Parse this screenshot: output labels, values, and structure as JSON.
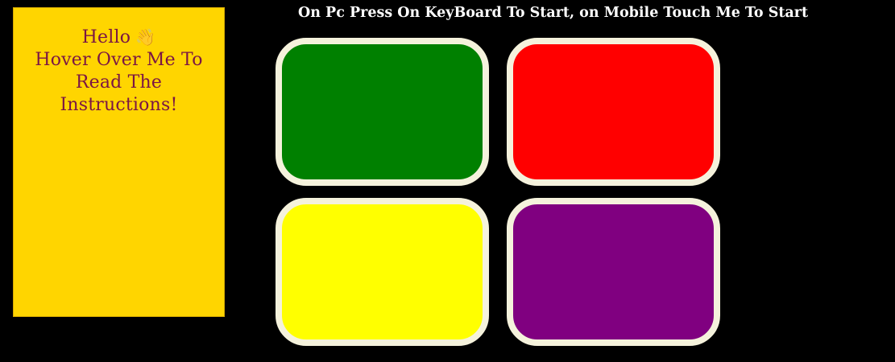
{
  "banner": {
    "text": "On Pc Press On KeyBoard To Start, on Mobile Touch Me To Start"
  },
  "instructions_panel": {
    "hello": "Hello",
    "wave_emoji": "👋",
    "lines": [
      "Hover Over Me To",
      "Read The",
      "Instructions!"
    ],
    "background": "#ffd500",
    "text_color": "#7a1545"
  },
  "pads": [
    {
      "name": "green",
      "color": "#008000"
    },
    {
      "name": "red",
      "color": "#ff0000"
    },
    {
      "name": "yellow",
      "color": "#ffff00"
    },
    {
      "name": "purple",
      "color": "#800080"
    }
  ],
  "pad_border_color": "#f5f2dc",
  "page_background": "#000000"
}
